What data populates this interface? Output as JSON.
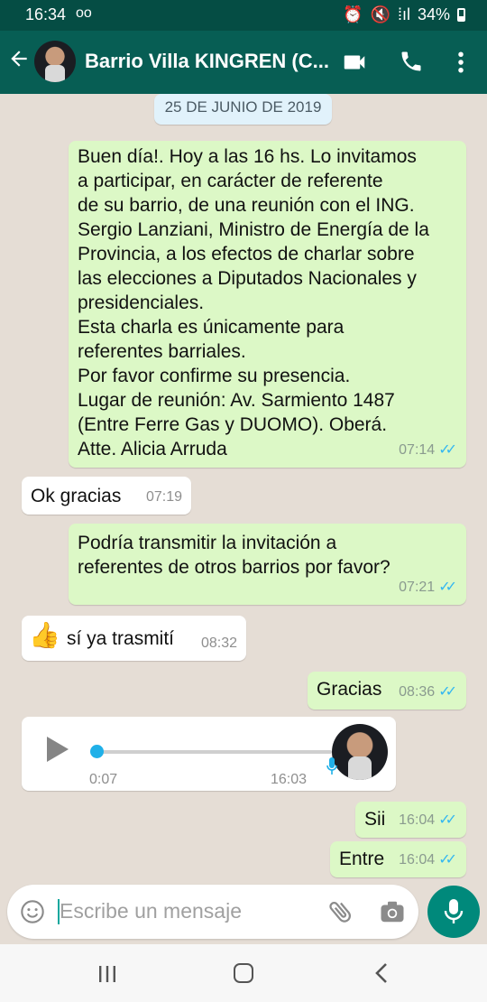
{
  "status_bar": {
    "time": "16:34",
    "voicemail": "oo",
    "battery": "34%"
  },
  "header": {
    "title": "Barrio Villa KINGREN (C..."
  },
  "chat": {
    "date_label": "25 DE JUNIO DE 2019",
    "messages": [
      {
        "direction": "out",
        "text": "Buen día!. Hoy a las 16 hs. Lo invitamos\na participar, en carácter de referente\nde su barrio, de una reunión con el ING.\nSergio Lanziani, Ministro de Energía de la\nProvincia, a los efectos de charlar sobre\nlas elecciones a Diputados Nacionales y\npresidenciales.\nEsta  charla es únicamente para\nreferentes barriales.\nPor favor confirme su presencia.\nLugar de reunión: Av. Sarmiento 1487\n(Entre Ferre Gas y DUOMO). Oberá.\nAtte. Alicia Arruda",
        "time": "07:14"
      },
      {
        "direction": "in",
        "text": "Ok gracias",
        "time": "07:19"
      },
      {
        "direction": "out",
        "text": "Podría transmitir la invitación a\nreferentes de otros barrios por favor?",
        "time": "07:21"
      },
      {
        "direction": "in",
        "emoji": "👍",
        "text": "sí ya trasmití",
        "time": "08:32"
      },
      {
        "direction": "out",
        "text": "Gracias",
        "time": "08:36"
      },
      {
        "direction": "in",
        "type": "voice",
        "duration": "0:07",
        "time": "16:03",
        "progress": 0.0
      },
      {
        "direction": "out",
        "text": "Sii",
        "time": "16:04"
      },
      {
        "direction": "out",
        "text": "Entre",
        "time": "16:04"
      }
    ]
  },
  "composer": {
    "placeholder": "Escribe un mensaje"
  },
  "icons": {
    "header": [
      "back-arrow-icon",
      "video-call-icon",
      "phone-icon",
      "more-vert-icon"
    ],
    "composer": [
      "emoji-icon",
      "attach-icon",
      "camera-icon",
      "mic-icon"
    ],
    "nav": [
      "recent-apps-icon",
      "home-icon",
      "back-icon"
    ]
  },
  "colors": {
    "header": "#075e54",
    "status_bar": "#054d44",
    "outgoing_bubble": "#dcf8c6",
    "incoming_bubble": "#ffffff",
    "read_tick": "#34b7f1",
    "mic_button": "#00897b"
  }
}
